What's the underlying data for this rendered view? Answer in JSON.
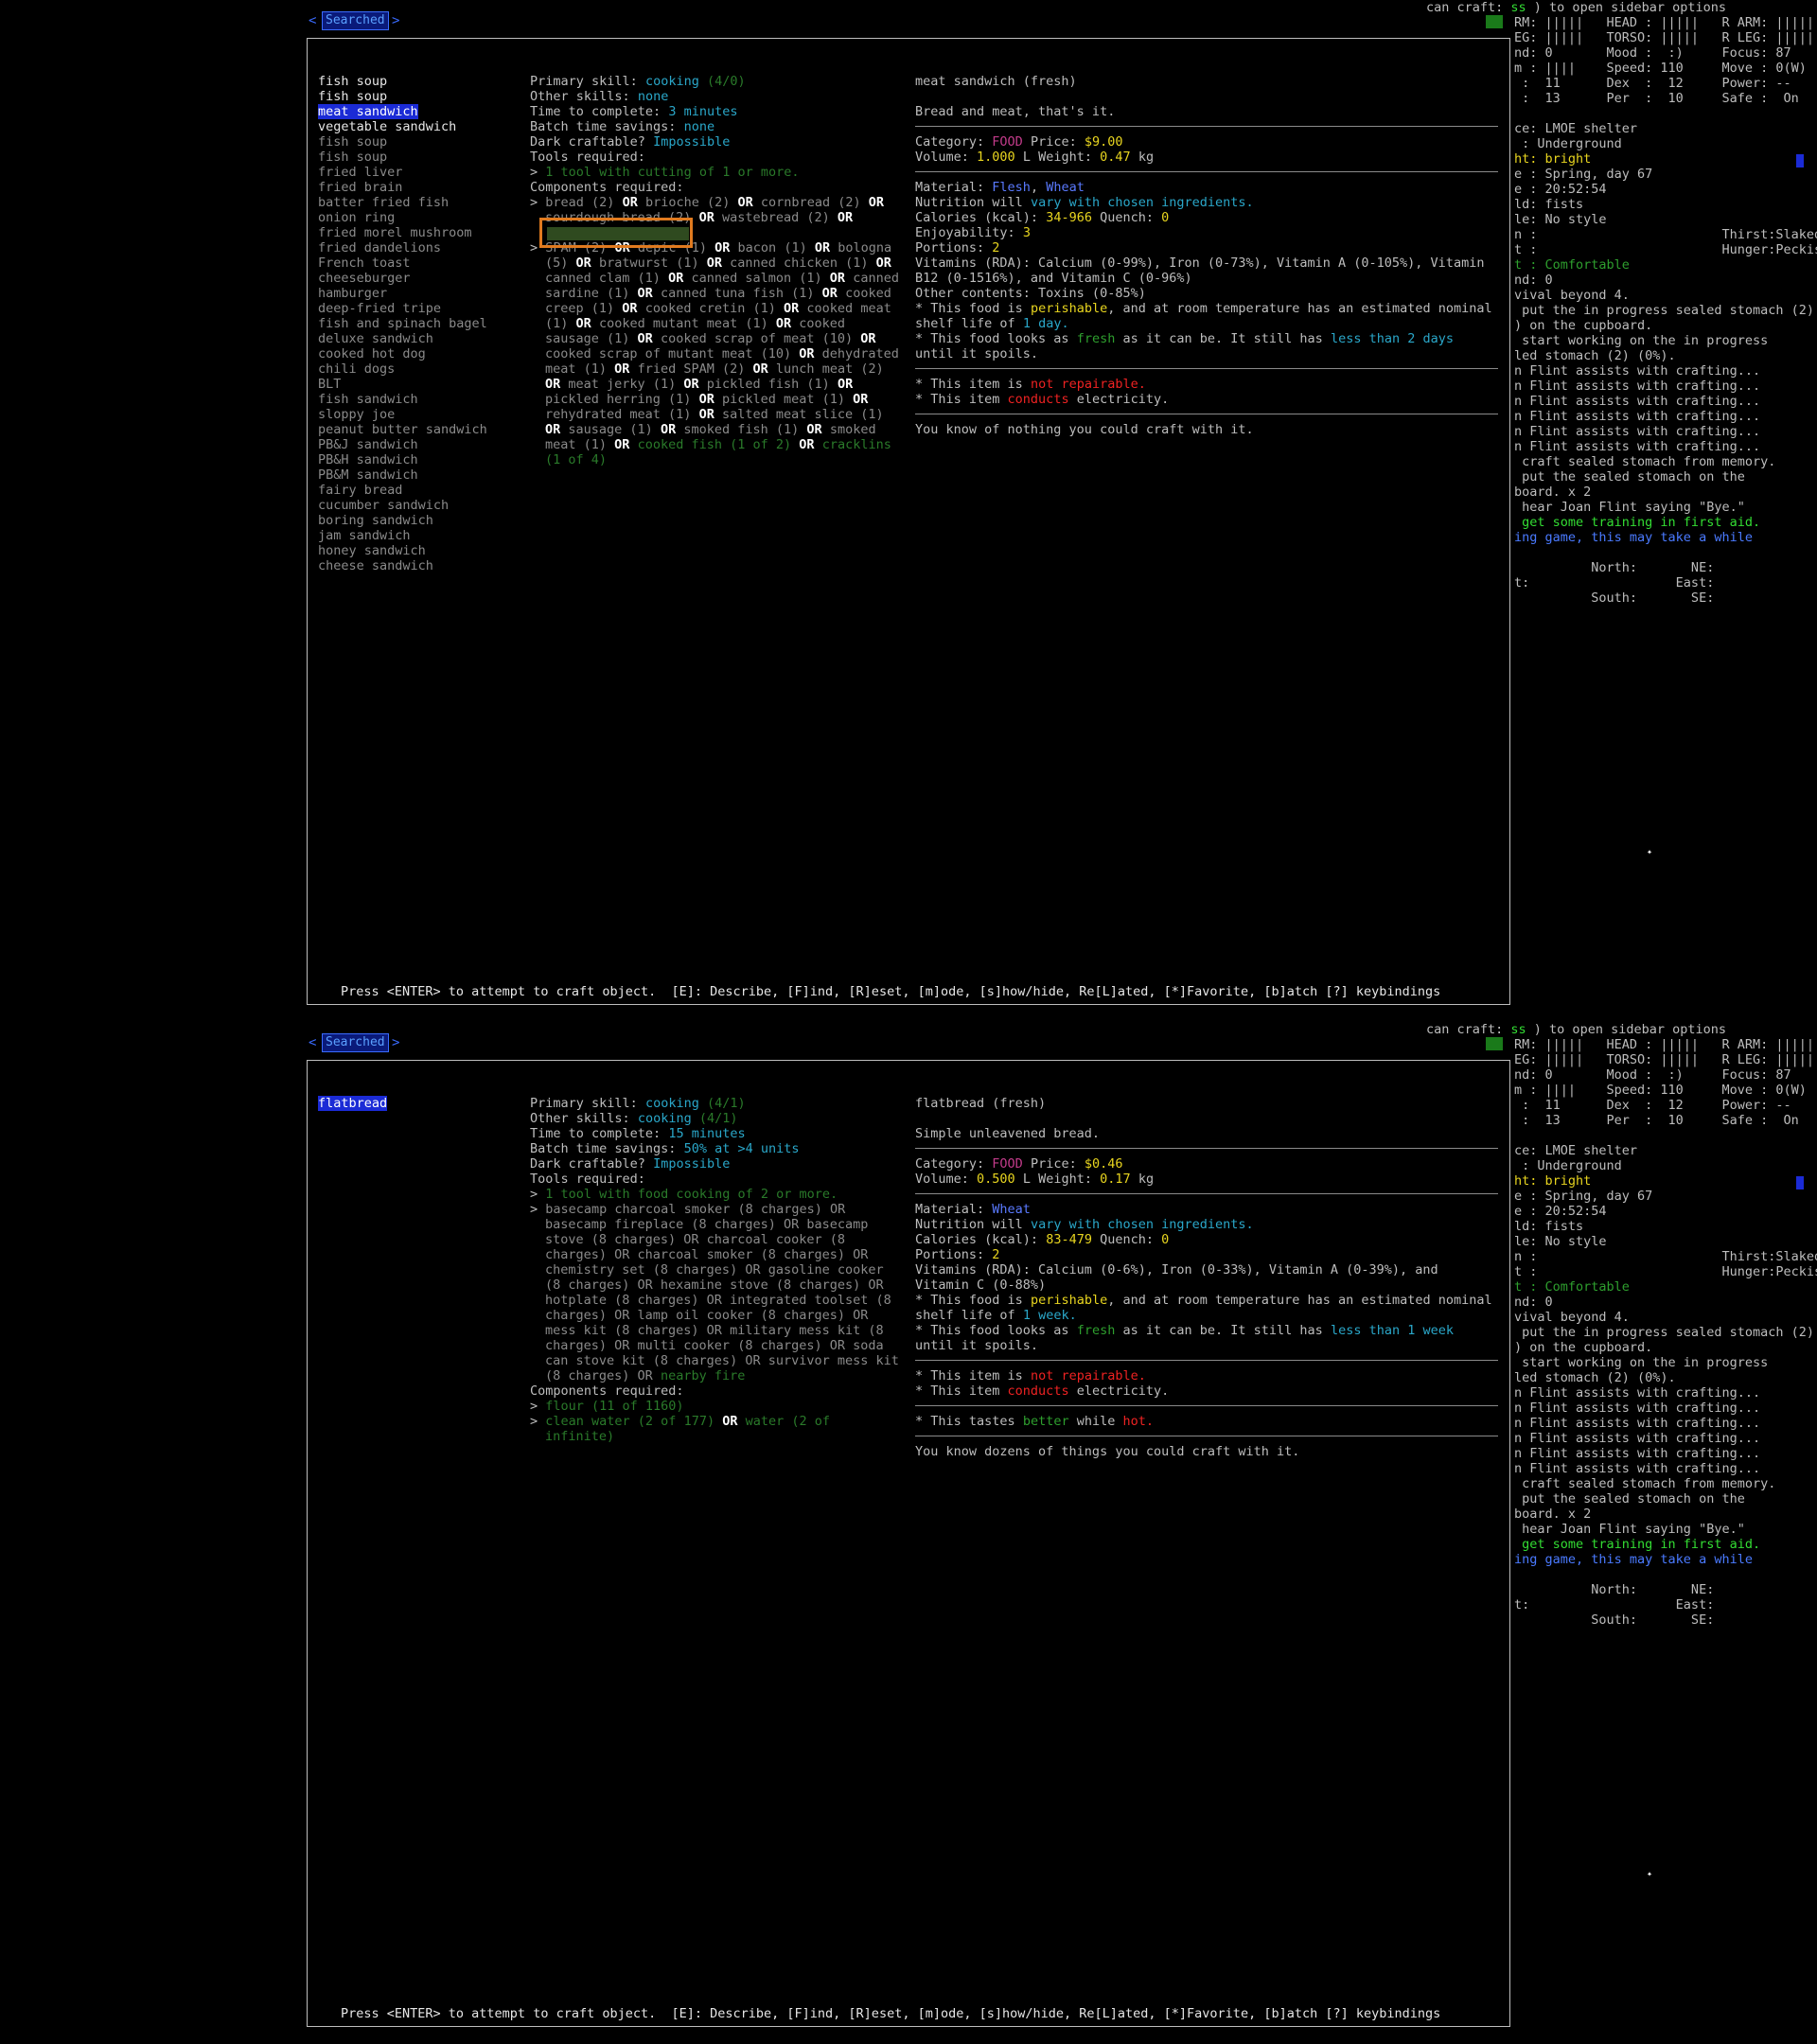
{
  "screens": [
    {
      "tab_label": "Searched",
      "recipes": [
        {
          "label": "fish soup",
          "style": "white"
        },
        {
          "label": "fish soup",
          "style": "white"
        },
        {
          "label": "meat sandwich",
          "style": "sel"
        },
        {
          "label": "vegetable sandwich",
          "style": "white"
        },
        {
          "label": "fish soup",
          "style": "gray"
        },
        {
          "label": "fish soup",
          "style": "gray"
        },
        {
          "label": "fried liver",
          "style": "gray"
        },
        {
          "label": "fried brain",
          "style": "gray"
        },
        {
          "label": "batter fried fish",
          "style": "gray"
        },
        {
          "label": "onion ring",
          "style": "gray"
        },
        {
          "label": "fried morel mushroom",
          "style": "gray"
        },
        {
          "label": "fried dandelions",
          "style": "gray"
        },
        {
          "label": "French toast",
          "style": "gray"
        },
        {
          "label": "cheeseburger",
          "style": "gray"
        },
        {
          "label": "hamburger",
          "style": "gray"
        },
        {
          "label": "deep-fried tripe",
          "style": "gray"
        },
        {
          "label": "fish and spinach bagel",
          "style": "gray"
        },
        {
          "label": "deluxe sandwich",
          "style": "gray"
        },
        {
          "label": "cooked hot dog",
          "style": "gray"
        },
        {
          "label": "chili dogs",
          "style": "gray"
        },
        {
          "label": "BLT",
          "style": "gray"
        },
        {
          "label": "fish sandwich",
          "style": "gray"
        },
        {
          "label": "sloppy joe",
          "style": "gray"
        },
        {
          "label": "peanut butter sandwich",
          "style": "gray"
        },
        {
          "label": "PB&J sandwich",
          "style": "gray"
        },
        {
          "label": "PB&H sandwich",
          "style": "gray"
        },
        {
          "label": "PB&M sandwich",
          "style": "gray"
        },
        {
          "label": "fairy bread",
          "style": "gray"
        },
        {
          "label": "cucumber sandwich",
          "style": "gray"
        },
        {
          "label": "boring sandwich",
          "style": "gray"
        },
        {
          "label": "jam sandwich",
          "style": "gray"
        },
        {
          "label": "honey sandwich",
          "style": "gray"
        },
        {
          "label": "cheese sandwich",
          "style": "gray"
        }
      ],
      "details": {
        "primary_skill_label": "Primary skill:",
        "primary_skill": "cooking",
        "primary_skill_level": "(4/0)",
        "other_skills_label": "Other skills:",
        "other_skills": "none",
        "time_label": "Time to complete:",
        "time": "3 minutes",
        "batch_label": "Batch time savings:",
        "batch": "none",
        "dark_label": "Dark craftable?",
        "dark": "Impossible",
        "tools_label": "Tools required:",
        "tools_line": "1 tool with cutting of 1 or more.",
        "components_label": "Components required:",
        "comp1_a": "bread (2)",
        "comp1_b": "brioche (2)",
        "comp1_c": "cornbread (2)",
        "comp1_d": "sourdough bread (2)",
        "comp1_e": "wastebread (2)",
        "comp2_a": "SPAM (2)",
        "comp2_b": "depic (1)",
        "comp2_c": "bacon (1)",
        "comp2_d": "bologna (5)",
        "comp2_e": "bratwurst (1)",
        "comp2_f": "canned chicken (1)",
        "comp2_g": "canned clam (1)",
        "comp2_h": "canned salmon (1)",
        "comp2_i": "canned sardine (1)",
        "comp2_j": "canned tuna fish (1)",
        "comp2_k": "cooked creep (1)",
        "comp2_l": "cooked cretin (1)",
        "comp2_m": "cooked meat (1)",
        "comp2_n": "cooked mutant meat (1)",
        "comp2_o": "cooked sausage (1)",
        "comp2_p": "cooked scrap of meat (10)",
        "comp2_q": "cooked scrap of mutant meat (10)",
        "comp2_r": "dehydrated meat (1)",
        "comp2_s": "fried SPAM (2)",
        "comp2_t": "lunch meat (2)",
        "comp2_u": "meat jerky (1)",
        "comp2_v": "pickled fish (1)",
        "comp2_w": "pickled herring (1)",
        "comp2_x": "pickled meat (1)",
        "comp2_y": "rehydrated meat (1)",
        "comp2_z": "salted meat slice (1)",
        "comp2_aa": "sausage (1)",
        "comp2_ab": "smoked fish (1)",
        "comp2_ac": "smoked meat (1)",
        "comp2_ad": "cooked fish (1 of 2)",
        "comp2_ae": "cracklins (1 of 4)",
        "or": "OR"
      },
      "info": {
        "name": "meat sandwich (fresh)",
        "desc": "Bread and meat, that's it.",
        "category_label": "Category:",
        "category": "FOOD",
        "price_label": "Price:",
        "price": "$9.00",
        "volume_label": "Volume:",
        "volume": "1.000",
        "volume_unit": "L",
        "weight_label": "Weight:",
        "weight": "0.47",
        "weight_unit": "kg",
        "material_label": "Material:",
        "material_a": "Flesh",
        "material_b": "Wheat",
        "nutrition_a": "Nutrition will",
        "nutrition_b": "vary with chosen ingredients.",
        "calories_label": "Calories (kcal):",
        "calories": "34-966",
        "quench_label": "Quench:",
        "quench": "0",
        "enjoy_label": "Enjoyability:",
        "enjoy": "3",
        "portions_label": "Portions:",
        "portions": "2",
        "vitamins": "Vitamins (RDA): Calcium (0-99%), Iron (0-73%), Vitamin A (0-105%), Vitamin B12 (0-1516%), and Vitamin C (0-96%)",
        "other_contents": "Other contents: Toxins (0-85%)",
        "perish_a": "* This food is",
        "perish_b": "perishable",
        "perish_c": ", and at room temperature has an estimated nominal shelf life of",
        "perish_d": "1 day.",
        "fresh_a": "* This food looks as",
        "fresh_b": "fresh",
        "fresh_c": "as it can be.  It still has",
        "fresh_d": "less than 2 days",
        "fresh_e": "until it spoils.",
        "repair_a": "* This item is",
        "repair_b": "not repairable.",
        "cond_a": "* This item",
        "cond_b": "conducts",
        "cond_c": "electricity.",
        "know": "You know of nothing you could craft with it."
      }
    },
    {
      "tab_label": "Searched",
      "recipes": [
        {
          "label": "flatbread",
          "style": "sel"
        }
      ],
      "details": {
        "primary_skill_label": "Primary skill:",
        "primary_skill": "cooking",
        "primary_skill_level": "(4/1)",
        "other_skills_label": "Other skills:",
        "other_skills": "cooking",
        "other_skills_level": "(4/1)",
        "time_label": "Time to complete:",
        "time": "15 minutes",
        "batch_label": "Batch time savings:",
        "batch_a": "50%",
        "batch_b": "at",
        "batch_c": ">4 units",
        "dark_label": "Dark craftable?",
        "dark": "Impossible",
        "tools_label": "Tools required:",
        "tools_line": "1 tool with food cooking of 2 or more.",
        "tools_list": "basecamp charcoal smoker (8 charges) OR basecamp fireplace (8 charges) OR basecamp stove (8 charges) OR charcoal cooker (8 charges) OR charcoal smoker (8 charges) OR chemistry set (8 charges) OR gasoline cooker (8 charges) OR hexamine stove (8 charges) OR hotplate (8 charges) OR integrated toolset (8 charges) OR lamp oil cooker (8 charges) OR mess kit (8 charges) OR military mess kit (8 charges) OR multi cooker (8 charges) OR soda can stove kit (8 charges) OR survivor mess kit (8 charges) OR",
        "tools_fire": "nearby fire",
        "components_label": "Components required:",
        "comp_flour": "flour (11 of 1160)",
        "comp_water": "clean water (2 of 177)",
        "comp_water_b": "water (2 of infinite)",
        "or": "OR"
      },
      "info": {
        "name": "flatbread (fresh)",
        "desc": "Simple unleavened bread.",
        "category_label": "Category:",
        "category": "FOOD",
        "price_label": "Price:",
        "price": "$0.46",
        "volume_label": "Volume:",
        "volume": "0.500",
        "volume_unit": "L",
        "weight_label": "Weight:",
        "weight": "0.17",
        "weight_unit": "kg",
        "material_label": "Material:",
        "material_a": "Wheat",
        "nutrition_a": "Nutrition will",
        "nutrition_b": "vary with chosen ingredients.",
        "calories_label": "Calories (kcal):",
        "calories": "83-479",
        "quench_label": "Quench:",
        "quench": "0",
        "portions_label": "Portions:",
        "portions": "2",
        "vitamins": "Vitamins (RDA): Calcium (0-6%), Iron (0-33%), Vitamin A (0-39%), and Vitamin C (0-88%)",
        "perish_a": "* This food is",
        "perish_b": "perishable",
        "perish_c": ", and at room temperature has an estimated nominal shelf life of",
        "perish_d": "1 week.",
        "fresh_a": "* This food looks as",
        "fresh_b": "fresh",
        "fresh_c": "as it can be.  It still has",
        "fresh_d": "less than 1 week",
        "fresh_e": "until it spoils.",
        "repair_a": "* This item is",
        "repair_b": "not repairable.",
        "cond_a": "* This item",
        "cond_b": "conducts",
        "cond_c": "electricity.",
        "taste_a": "* This tastes",
        "taste_b": "better",
        "taste_c": "while",
        "taste_d": "hot.",
        "know": "You know dozens of things you could craft with it."
      }
    }
  ],
  "footer": "Press <ENTER> to attempt to craft object.  [E]: Describe, [F]ind, [R]eset, [m]ode, [s]how/hide, Re[L]ated, [*]Favorite, [b]atch [?] keybindings",
  "sidebar": {
    "topline_a": "can craft:",
    "topline_b": "ss",
    "topline_c": ") to open sidebar options",
    "rows": [
      "RM: |||||   HEAD : |||||   R ARM: |||||",
      "EG: |||||   TORSO: |||||   R LEG: |||||",
      "nd: 0       Mood :  :)     Focus: 87",
      "m : ||||    Speed: 110     Move : 0(W)",
      " :  11      Dex  :  12     Power: --",
      " :  13      Per  :  10     Safe :  On",
      "",
      "ce: LMOE shelter",
      " : Underground",
      "ht: bright",
      "e : Spring, day 67",
      "e : 20:52:54",
      "ld: fists",
      "le: No style",
      "n :                        Thirst:Slaked",
      "t :                        Hunger:Peckish",
      "t : Comfortable",
      "nd: 0",
      "vival beyond 4.",
      " put the in progress sealed stomach (2)",
      ") on the cupboard.",
      " start working on the in progress",
      "led stomach (2) (0%).",
      "n Flint assists with crafting...",
      "n Flint assists with crafting...",
      "n Flint assists with crafting...",
      "n Flint assists with crafting...",
      "n Flint assists with crafting...",
      "n Flint assists with crafting...",
      " craft sealed stomach from memory.",
      " put the sealed stomach on the",
      "board. x 2",
      " hear Joan Flint saying \"Bye.\"",
      " get some training in first aid.",
      "ing game, this may take a while",
      "",
      "          North:       NE:",
      "t:                   East:",
      "          South:       SE:"
    ]
  }
}
